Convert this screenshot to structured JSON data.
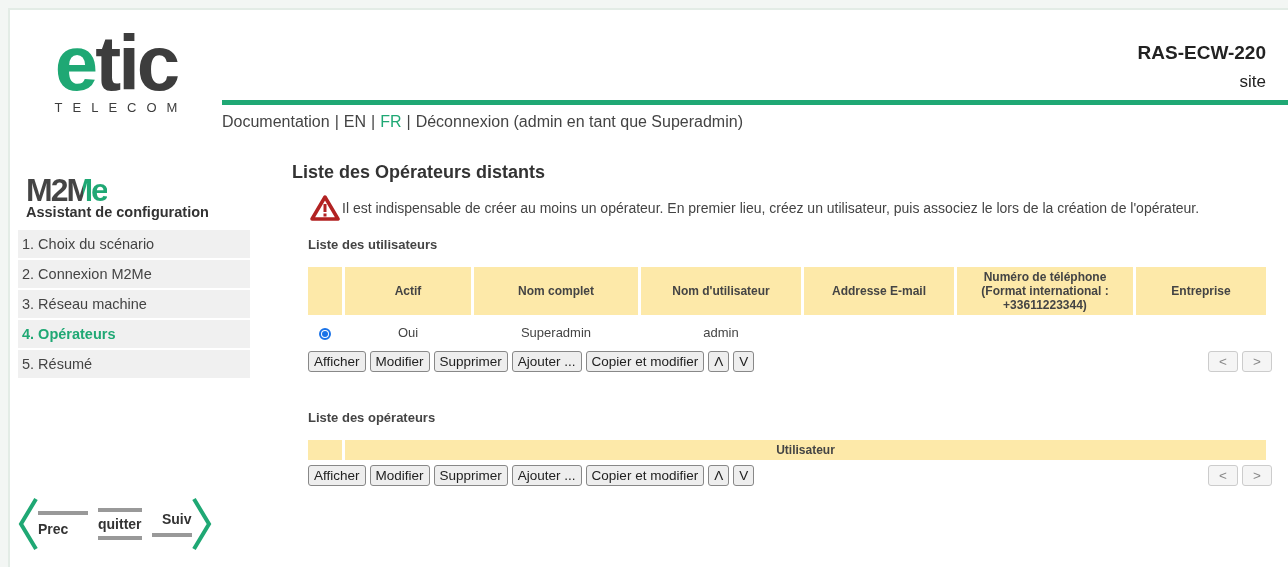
{
  "header": {
    "logo": {
      "name": "etic",
      "tagline": "TELECOM"
    },
    "device": "RAS-ECW-220",
    "site": "site",
    "nav": {
      "separator": "|",
      "items": [
        {
          "label": "Documentation",
          "selected": false
        },
        {
          "label": "EN",
          "selected": false
        },
        {
          "label": "FR",
          "selected": true
        },
        {
          "label": "Déconnexion (admin en tant que Superadmin)",
          "selected": false
        }
      ]
    }
  },
  "sidebar": {
    "brand": "M2Me",
    "subtitle": "Assistant de configuration",
    "steps": [
      {
        "label": "1. Choix du scénario",
        "selected": false
      },
      {
        "label": "2. Connexion M2Me",
        "selected": false
      },
      {
        "label": "3. Réseau machine",
        "selected": false
      },
      {
        "label": "4. Opérateurs",
        "selected": true
      },
      {
        "label": "5. Résumé",
        "selected": false
      }
    ],
    "wizard": {
      "prev": "Prec",
      "quit": "quitter",
      "next": "Suiv"
    }
  },
  "main": {
    "title": "Liste des Opérateurs distants",
    "warning": "Il est indispensable de créer au moins un opérateur. En premier lieu, créez un utilisateur, puis associez le lors de la création de l'opérateur.",
    "users": {
      "title": "Liste des utilisateurs",
      "columns": [
        "Actif",
        "Nom complet",
        "Nom d'utilisateur",
        "Addresse E-mail",
        "Numéro de téléphone (Format international : +33611223344)",
        "Entreprise"
      ],
      "rows": [
        {
          "selected": true,
          "cells": [
            "Oui",
            "Superadmin",
            "admin",
            "",
            "",
            ""
          ]
        }
      ],
      "buttons": [
        "Afficher",
        "Modifier",
        "Supprimer",
        "Ajouter ...",
        "Copier et modifier",
        "Λ",
        "V"
      ],
      "pager": [
        "<",
        ">"
      ]
    },
    "operators": {
      "title": "Liste des opérateurs",
      "columns": [
        "Utilisateur"
      ],
      "buttons": [
        "Afficher",
        "Modifier",
        "Supprimer",
        "Ajouter ...",
        "Copier et modifier",
        "Λ",
        "V"
      ],
      "pager": [
        "<",
        ">"
      ]
    }
  }
}
